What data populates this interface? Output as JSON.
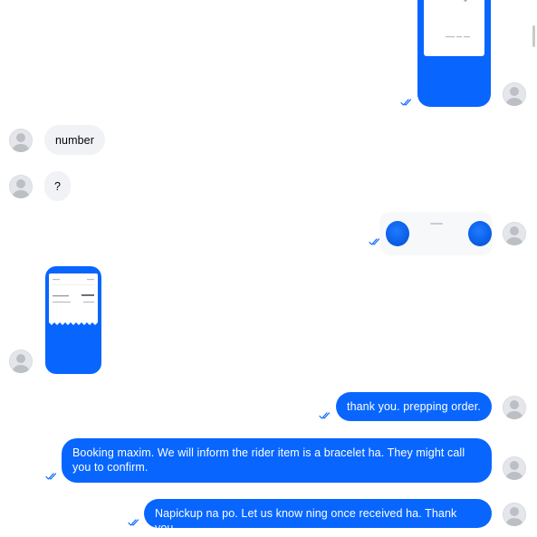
{
  "colors": {
    "outgoing_bubble": "#0866ff",
    "incoming_bubble": "#f0f2f5",
    "read_check": "#0866ff",
    "avatar_bg": "#e4e6eb"
  },
  "icons": {
    "avatar": "default-user-avatar-icon",
    "sent": "double-check-icon"
  },
  "messages": [
    {
      "id": "m1",
      "direction": "outgoing",
      "kind": "image",
      "content": "receipt-photo"
    },
    {
      "id": "m2",
      "direction": "incoming",
      "kind": "text",
      "text": "number"
    },
    {
      "id": "m3",
      "direction": "incoming",
      "kind": "text",
      "text": "?"
    },
    {
      "id": "m4",
      "direction": "outgoing",
      "kind": "image",
      "content": "blue-bead-bracelet-photo"
    },
    {
      "id": "m5",
      "direction": "incoming",
      "kind": "image",
      "content": "payment-receipt-screenshot"
    },
    {
      "id": "m6",
      "direction": "outgoing",
      "kind": "text",
      "text": "thank you. prepping order."
    },
    {
      "id": "m7",
      "direction": "outgoing",
      "kind": "text",
      "text": "Booking maxim. We will inform the rider item is a bracelet ha. They might call you to confirm."
    },
    {
      "id": "m8",
      "direction": "outgoing",
      "kind": "text",
      "text": "Napickup na po. Let us know ning once received ha. Thank you."
    }
  ]
}
